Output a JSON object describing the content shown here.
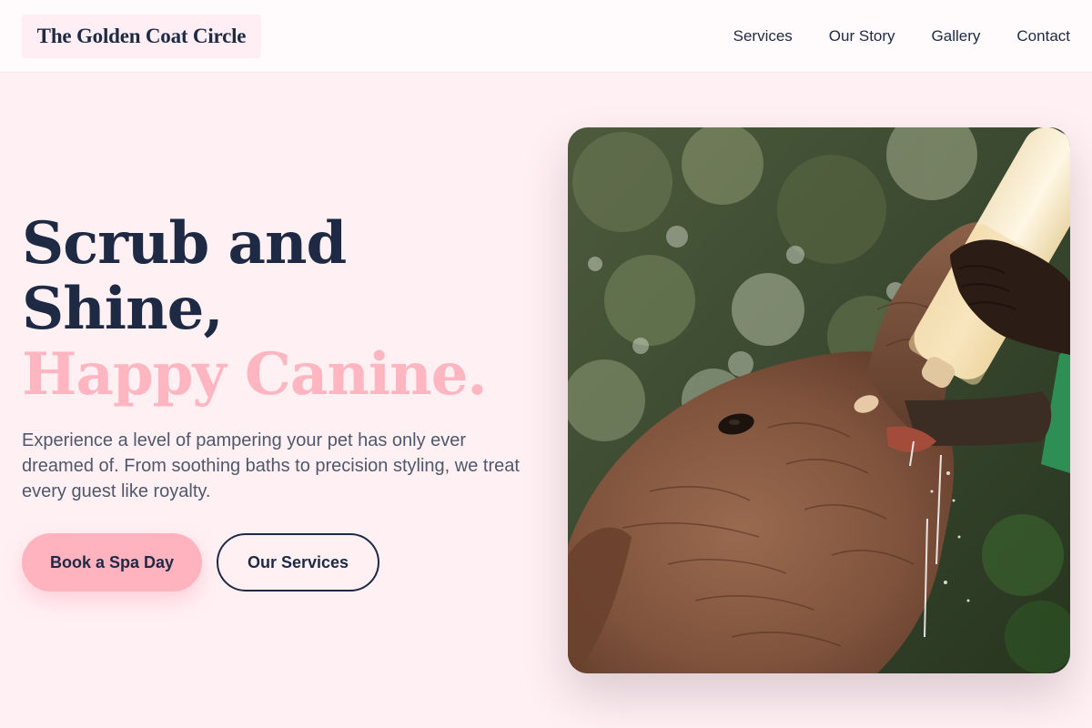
{
  "brand": {
    "name": "The Golden Coat Circle"
  },
  "nav": {
    "items": [
      {
        "label": "Services"
      },
      {
        "label": "Our Story"
      },
      {
        "label": "Gallery"
      },
      {
        "label": "Contact"
      }
    ]
  },
  "hero": {
    "title_line1": "Scrub and",
    "title_line2": "Shine,",
    "title_accent": "Happy Canine.",
    "description": "Experience a level of pampering your pet has only ever dreamed of. From soothing baths to precision styling, we treat every guest like royalty.",
    "primary_button": "Book a Spa Day",
    "secondary_button": "Our Services"
  },
  "colors": {
    "background": "#fff0f4",
    "navy": "#1e2a44",
    "accent_pink": "#ffb6c1",
    "button_pink": "#ffb3be"
  }
}
